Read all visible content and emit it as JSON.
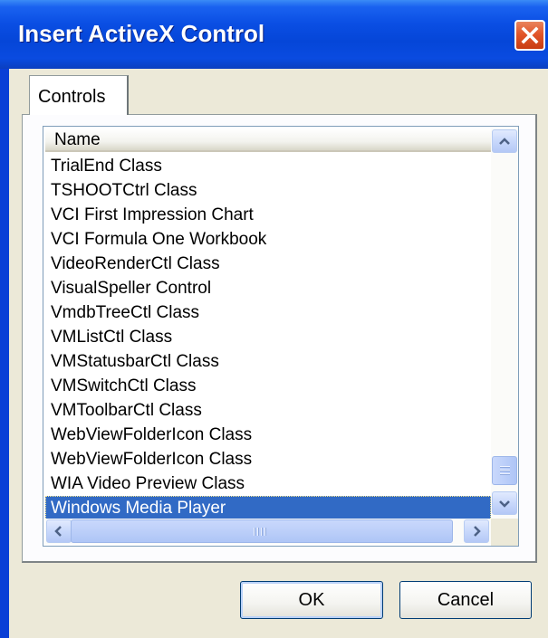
{
  "window": {
    "title": "Insert ActiveX Control"
  },
  "tabs": [
    {
      "label": "Controls"
    }
  ],
  "list": {
    "column_header": "Name",
    "items": [
      "TrialEnd Class",
      "TSHOOTCtrl Class",
      "VCI First Impression Chart",
      "VCI Formula One Workbook",
      "VideoRenderCtl Class",
      "VisualSpeller Control",
      "VmdbTreeCtl Class",
      "VMListCtl Class",
      "VMStatusbarCtl Class",
      "VMSwitchCtl Class",
      "VMToolbarCtl Class",
      "WebViewFolderIcon Class",
      "WebViewFolderIcon Class",
      "WIA Video Preview Class",
      "Windows Media Player"
    ],
    "selected_item": "Windows Media Player"
  },
  "buttons": {
    "ok_label": "OK",
    "cancel_label": "Cancel"
  },
  "icons": {
    "close": "close-icon",
    "scroll_up": "chevron-up-icon",
    "scroll_down": "chevron-down-icon",
    "scroll_left": "chevron-left-icon",
    "scroll_right": "chevron-right-icon"
  },
  "colors": {
    "titlebar": "#0546d8",
    "dialog_face": "#ece9d8",
    "selection": "#316ac5",
    "close_button": "#e2562a"
  }
}
